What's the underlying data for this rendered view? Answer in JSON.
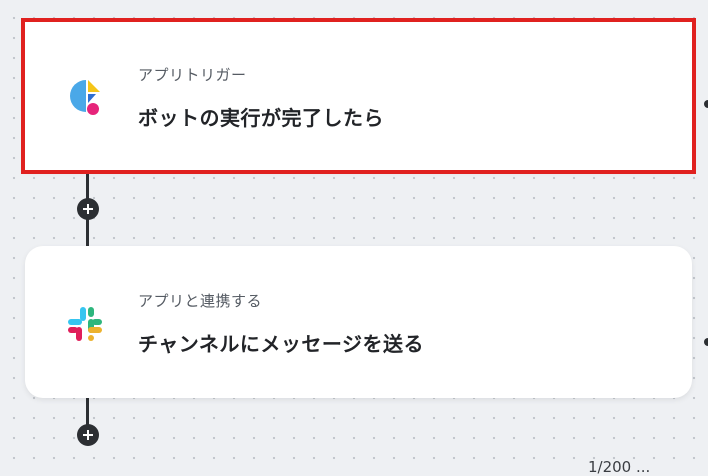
{
  "steps": [
    {
      "kind": "アプリトリガー",
      "title": "ボットの実行が完了したら",
      "icon": "flow-bot-app-icon",
      "selected": true
    },
    {
      "kind": "アプリと連携する",
      "title": "チャンネルにメッセージを送る",
      "icon": "slack-icon",
      "selected": false
    }
  ],
  "add_step_icon": "plus-icon",
  "footer": {
    "counter": "1/200 ..."
  },
  "colors": {
    "selection_border": "#e0211f",
    "connector": "#2c2f33",
    "canvas": "#eef0f3"
  }
}
